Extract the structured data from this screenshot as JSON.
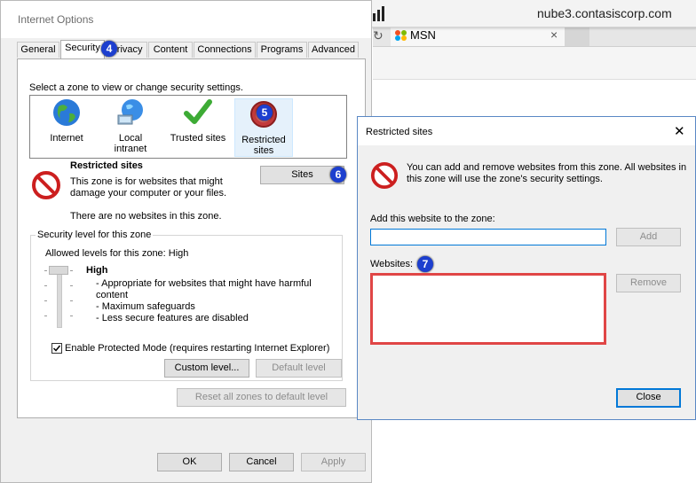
{
  "browser": {
    "url": "nube3.contasiscorp.com",
    "tab_label": "MSN",
    "tab_close": "×",
    "refresh_glyph": "↻"
  },
  "internet_options": {
    "title": "Internet Options",
    "tabs": [
      "General",
      "Security",
      "Privacy",
      "Content",
      "Connections",
      "Programs",
      "Advanced"
    ],
    "active_tab": "Security",
    "zone_prompt": "Select a zone to view or change security settings.",
    "zones": [
      {
        "label": "Internet",
        "icon": "globe-icon"
      },
      {
        "label": "Local intranet",
        "icon": "intranet-globe-icon"
      },
      {
        "label": "Trusted sites",
        "icon": "checkmark-icon"
      },
      {
        "label": "Restricted sites",
        "icon": "restricted-icon"
      }
    ],
    "selected_zone": "Restricted sites",
    "zone_heading": "Restricted sites",
    "zone_description": "This zone is for websites that might damage your computer or your files.",
    "zone_no_sites": "There are no websites in this zone.",
    "sites_button": "Sites",
    "security_group_label": "Security level for this zone",
    "allowed_levels": "Allowed levels for this zone: High",
    "level_name": "High",
    "level_bullets": [
      "- Appropriate for websites that might have harmful content",
      "- Maximum safeguards",
      "- Less secure features are disabled"
    ],
    "protected_mode_label": "Enable Protected Mode (requires restarting Internet Explorer)",
    "protected_mode_checked": true,
    "custom_level_button": "Custom level...",
    "default_level_button": "Default level",
    "reset_button": "Reset all zones to default level",
    "ok_button": "OK",
    "cancel_button": "Cancel",
    "apply_button": "Apply"
  },
  "restricted_dialog": {
    "title": "Restricted sites",
    "close_glyph": "✕",
    "info": "You can add and remove websites from this zone. All websites in this zone will use the zone's security settings.",
    "add_label": "Add this website to the zone:",
    "add_input_value": "",
    "add_button": "Add",
    "websites_label": "Websites:",
    "remove_button": "Remove",
    "close_button": "Close"
  },
  "badges": [
    "4",
    "5",
    "6",
    "7"
  ],
  "colors": {
    "badge": "#1d3fcf",
    "highlight": "#e04646",
    "focus": "#0078d7"
  }
}
